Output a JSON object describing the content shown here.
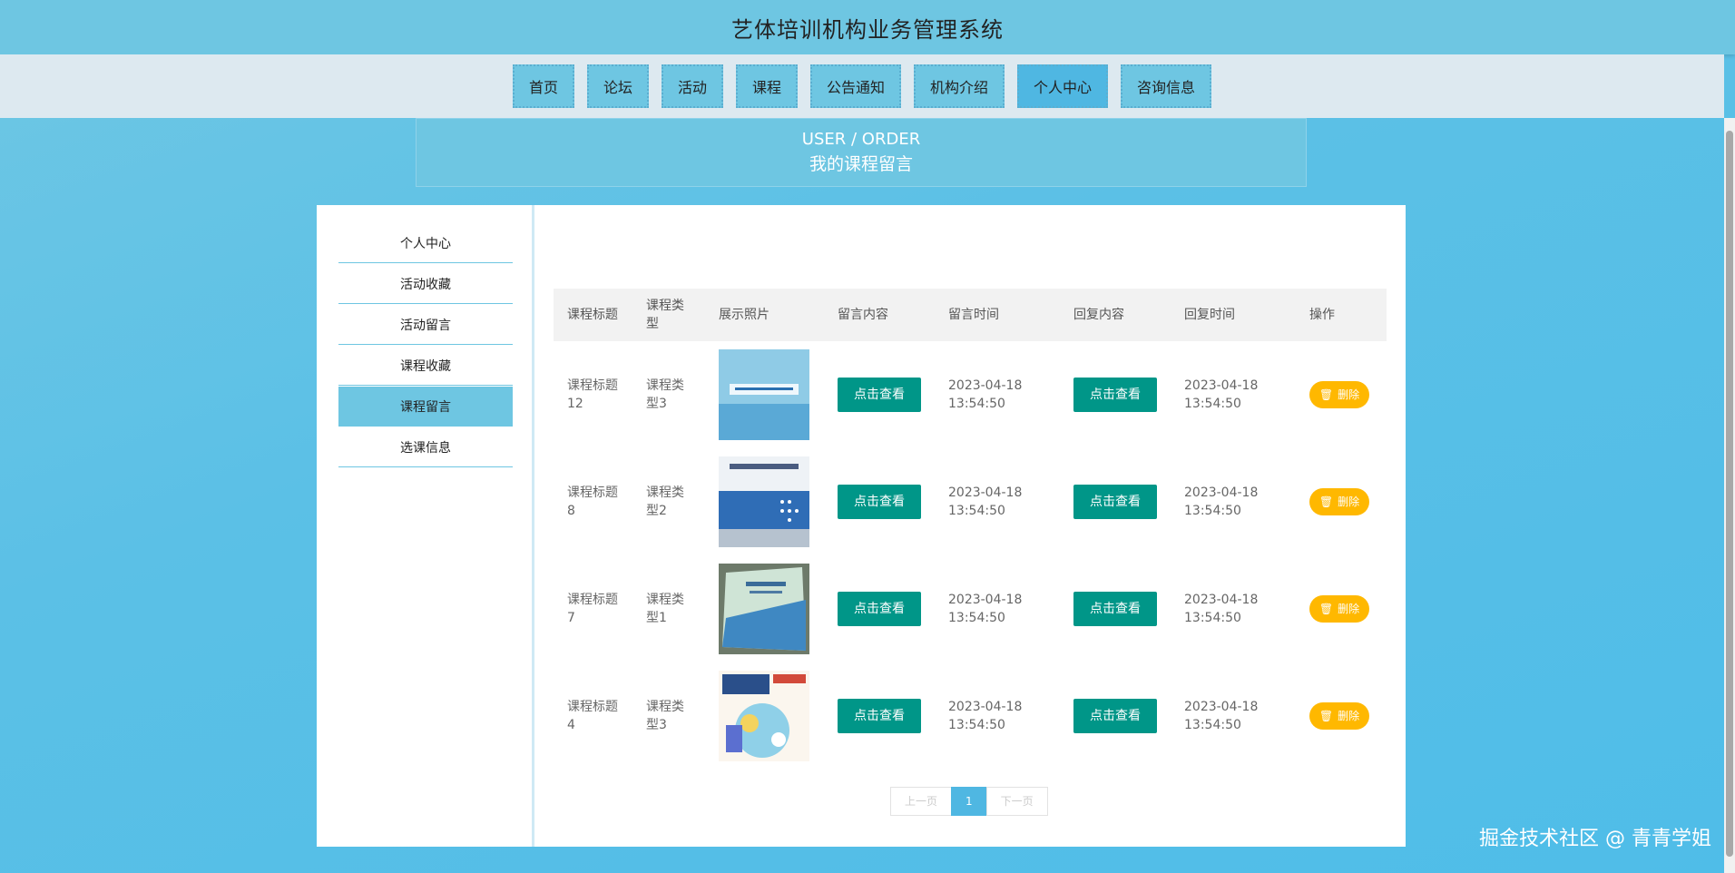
{
  "header": {
    "title": "艺体培训机构业务管理系统"
  },
  "nav": [
    {
      "label": "首页",
      "active": false
    },
    {
      "label": "论坛",
      "active": false
    },
    {
      "label": "活动",
      "active": false
    },
    {
      "label": "课程",
      "active": false
    },
    {
      "label": "公告通知",
      "active": false
    },
    {
      "label": "机构介绍",
      "active": false
    },
    {
      "label": "个人中心",
      "active": true
    },
    {
      "label": "咨询信息",
      "active": false
    }
  ],
  "breadcrumb": {
    "en": "USER / ORDER",
    "cn": "我的课程留言"
  },
  "sidebar": [
    {
      "label": "个人中心",
      "active": false
    },
    {
      "label": "活动收藏",
      "active": false
    },
    {
      "label": "活动留言",
      "active": false
    },
    {
      "label": "课程收藏",
      "active": false
    },
    {
      "label": "课程留言",
      "active": true
    },
    {
      "label": "选课信息",
      "active": false
    }
  ],
  "table": {
    "headers": [
      "课程标题",
      "课程类型",
      "展示照片",
      "留言内容",
      "留言时间",
      "回复内容",
      "回复时间",
      "操作"
    ],
    "rows": [
      {
        "title": "课程标题12",
        "type": "课程类型3",
        "photo_icon": "book-cover-network-basics",
        "view_label": "点击查看",
        "msg_time": "2023-04-18 13:54:50",
        "reply_label": "点击查看",
        "reply_time": "2023-04-18 13:54:50",
        "delete_label": "删除"
      },
      {
        "title": "课程标题8",
        "type": "课程类型2",
        "photo_icon": "book-cover-network-design",
        "view_label": "点击查看",
        "msg_time": "2023-04-18 13:54:50",
        "reply_label": "点击查看",
        "reply_time": "2023-04-18 13:54:50",
        "delete_label": "删除"
      },
      {
        "title": "课程标题7",
        "type": "课程类型1",
        "photo_icon": "book-cover-textbook",
        "view_label": "点击查看",
        "msg_time": "2023-04-18 13:54:50",
        "reply_label": "点击查看",
        "reply_time": "2023-04-18 13:54:50",
        "delete_label": "删除"
      },
      {
        "title": "课程标题4",
        "type": "课程类型3",
        "photo_icon": "book-cover-math",
        "view_label": "点击查看",
        "msg_time": "2023-04-18 13:54:50",
        "reply_label": "点击查看",
        "reply_time": "2023-04-18 13:54:50",
        "delete_label": "删除"
      }
    ]
  },
  "pager": {
    "prev": "上一页",
    "current": "1",
    "next": "下一页"
  },
  "footer": {
    "credit": "掘金技术社区 @ 青青学姐"
  },
  "colors": {
    "accent": "#6ec6e2",
    "view_button": "#009688",
    "delete_button": "#ffb800"
  }
}
